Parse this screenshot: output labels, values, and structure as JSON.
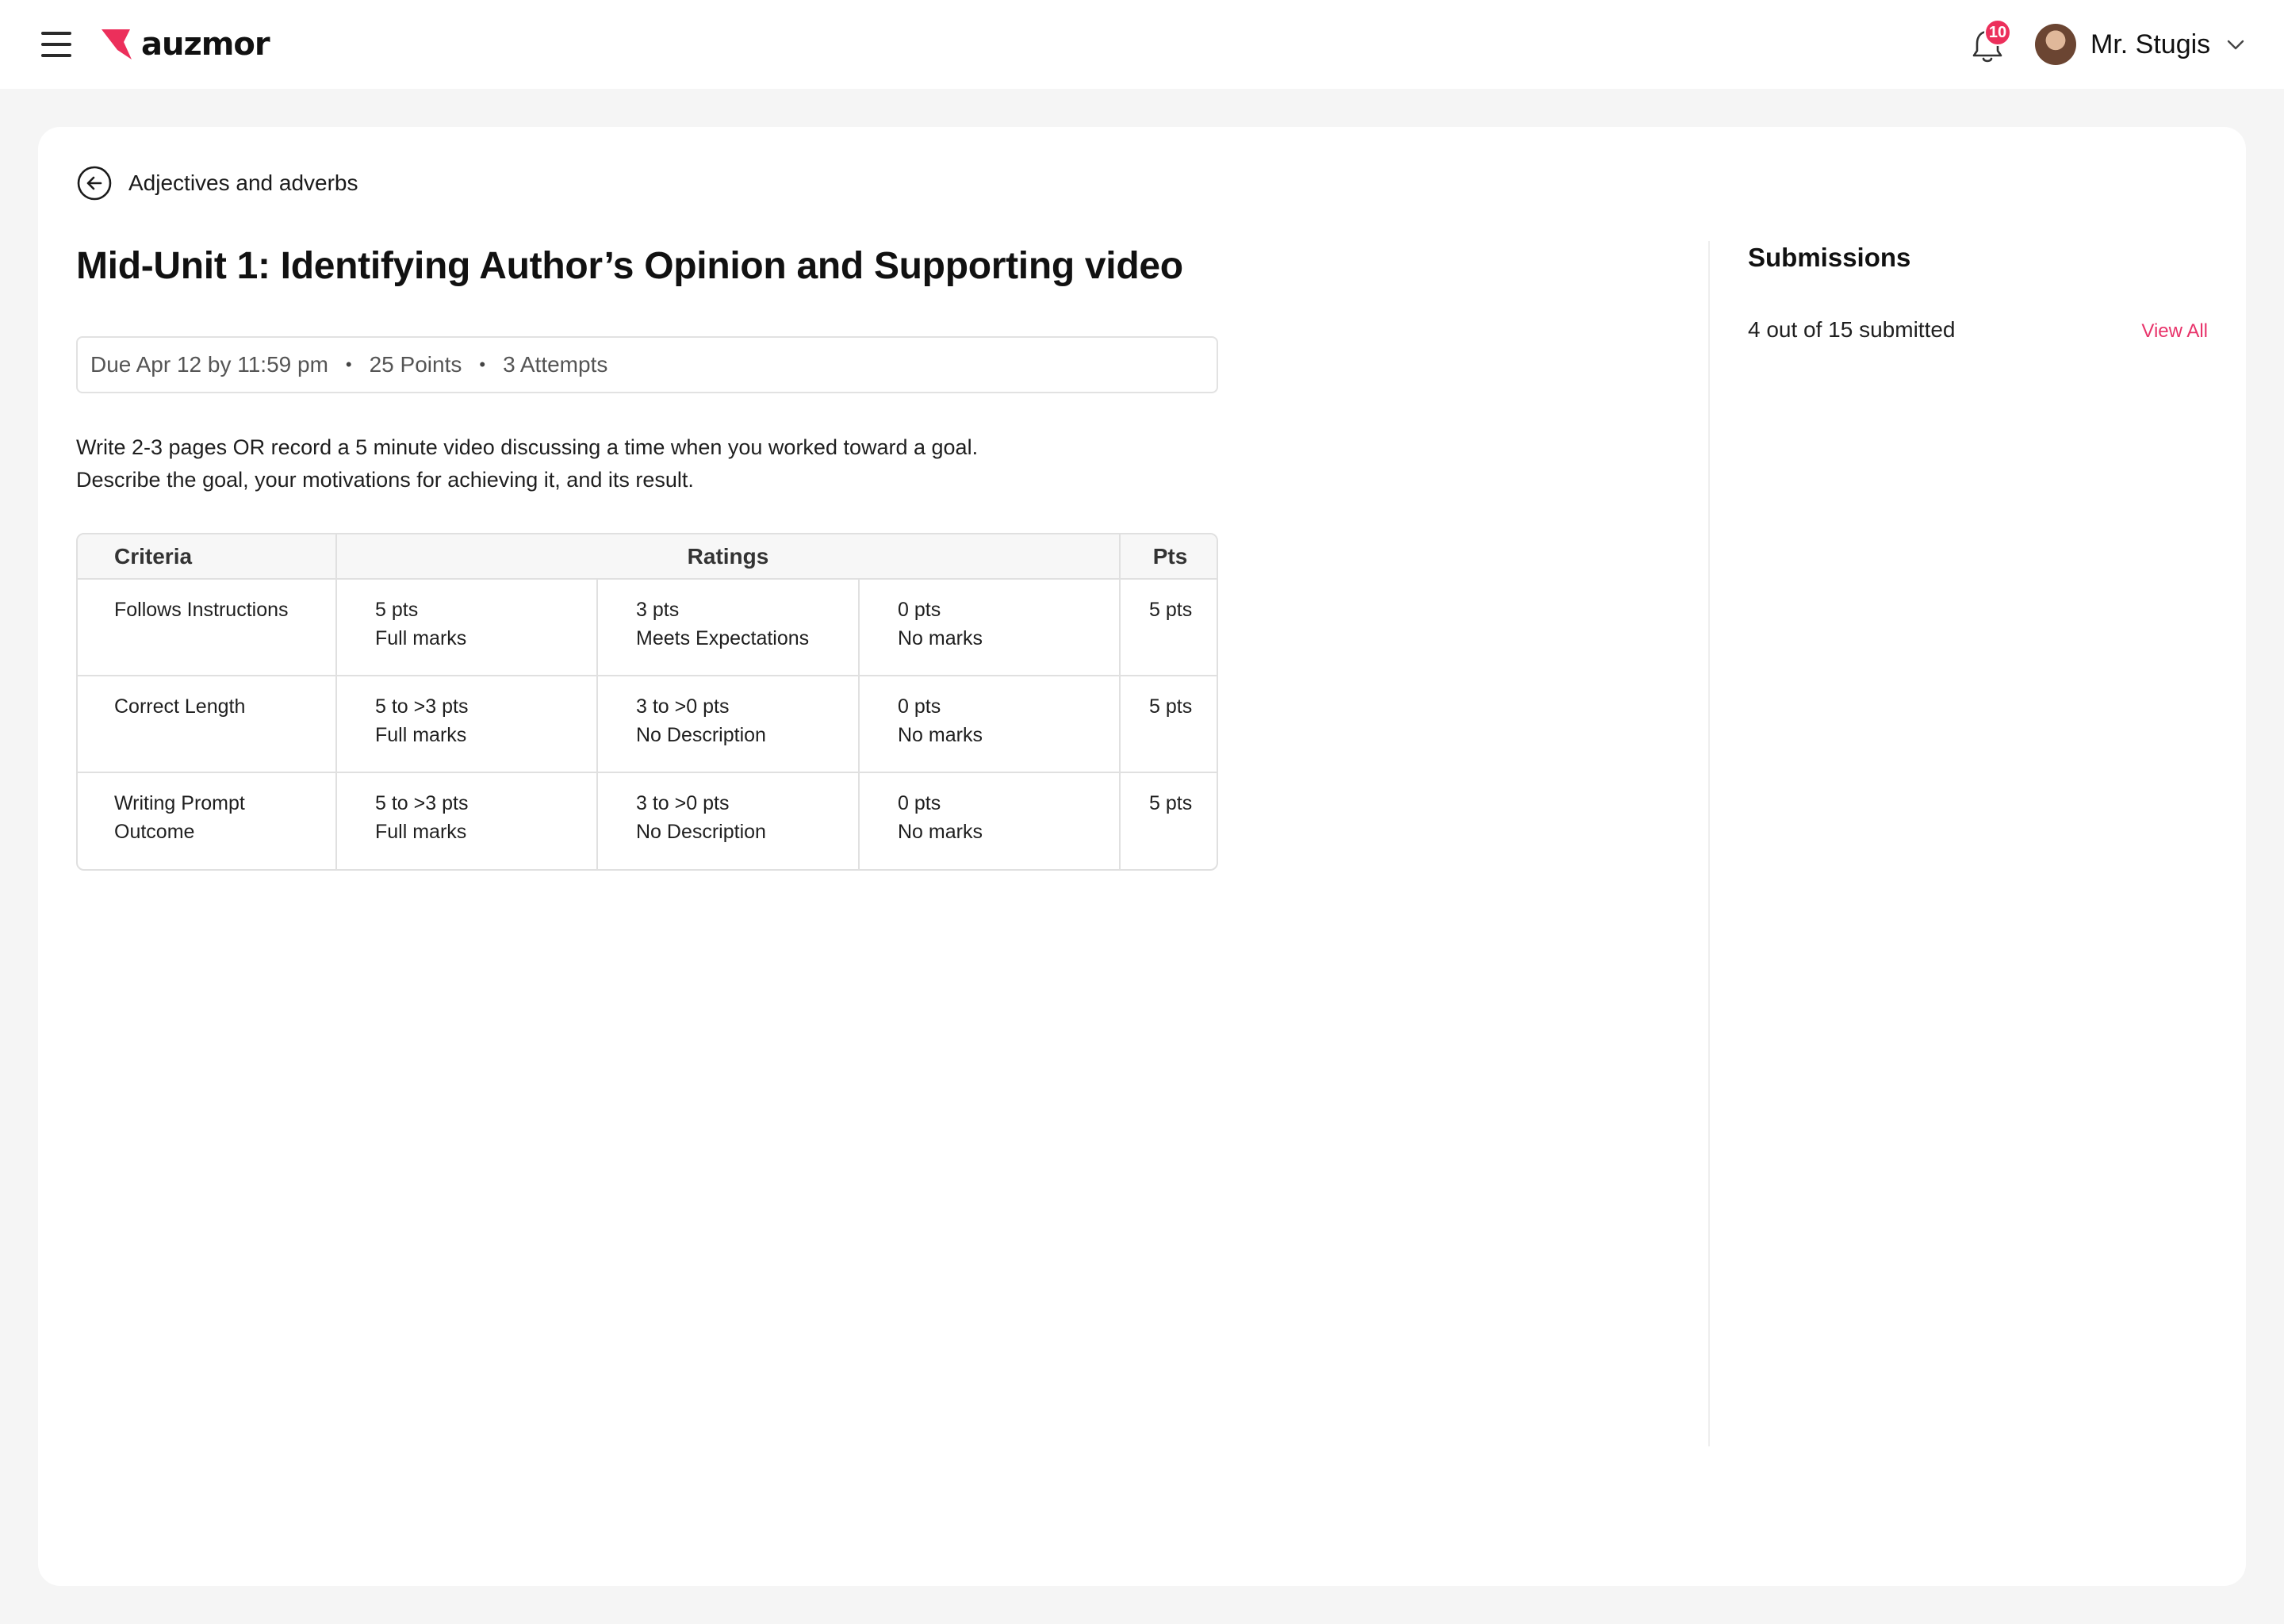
{
  "header": {
    "logo_text": "auzmor",
    "brand_color": "#ec2f5b",
    "notification_count": "10",
    "user_name": "Mr. Stugis"
  },
  "back": {
    "label": "Adjectives and adverbs"
  },
  "assignment": {
    "title": "Mid-Unit 1: Identifying Author’s Opinion and Supporting video",
    "due": "Due Apr 12 by 11:59 pm",
    "points": "25 Points",
    "attempts": "3 Attempts",
    "separator": "•",
    "description_line1": "Write 2-3 pages OR record a 5 minute video discussing a time when you worked toward a goal.",
    "description_line2": "Describe the goal, your motivations for achieving it, and its result."
  },
  "rubric": {
    "headers": {
      "criteria": "Criteria",
      "ratings": "Ratings",
      "pts": "Pts"
    },
    "rows": [
      {
        "criteria": "Follows Instructions",
        "ratings": [
          {
            "pts": "5 pts",
            "desc": "Full marks"
          },
          {
            "pts": "3 pts",
            "desc": "Meets Expectations"
          },
          {
            "pts": "0 pts",
            "desc": "No marks"
          }
        ],
        "pts": "5 pts"
      },
      {
        "criteria": "Correct Length",
        "ratings": [
          {
            "pts": "5 to >3 pts",
            "desc": "Full marks"
          },
          {
            "pts": "3 to >0 pts",
            "desc": "No Description"
          },
          {
            "pts": "0 pts",
            "desc": "No marks"
          }
        ],
        "pts": "5 pts"
      },
      {
        "criteria_line1": "Writing Prompt",
        "criteria_line2": "Outcome",
        "ratings": [
          {
            "pts": "5 to >3 pts",
            "desc": "Full marks"
          },
          {
            "pts": "3 to >0 pts",
            "desc": "No Description"
          },
          {
            "pts": "0 pts",
            "desc": "No marks"
          }
        ],
        "pts": "5 pts"
      }
    ]
  },
  "submissions": {
    "title": "Submissions",
    "count_text": "4 out of 15 submitted",
    "view_all": "View All"
  }
}
